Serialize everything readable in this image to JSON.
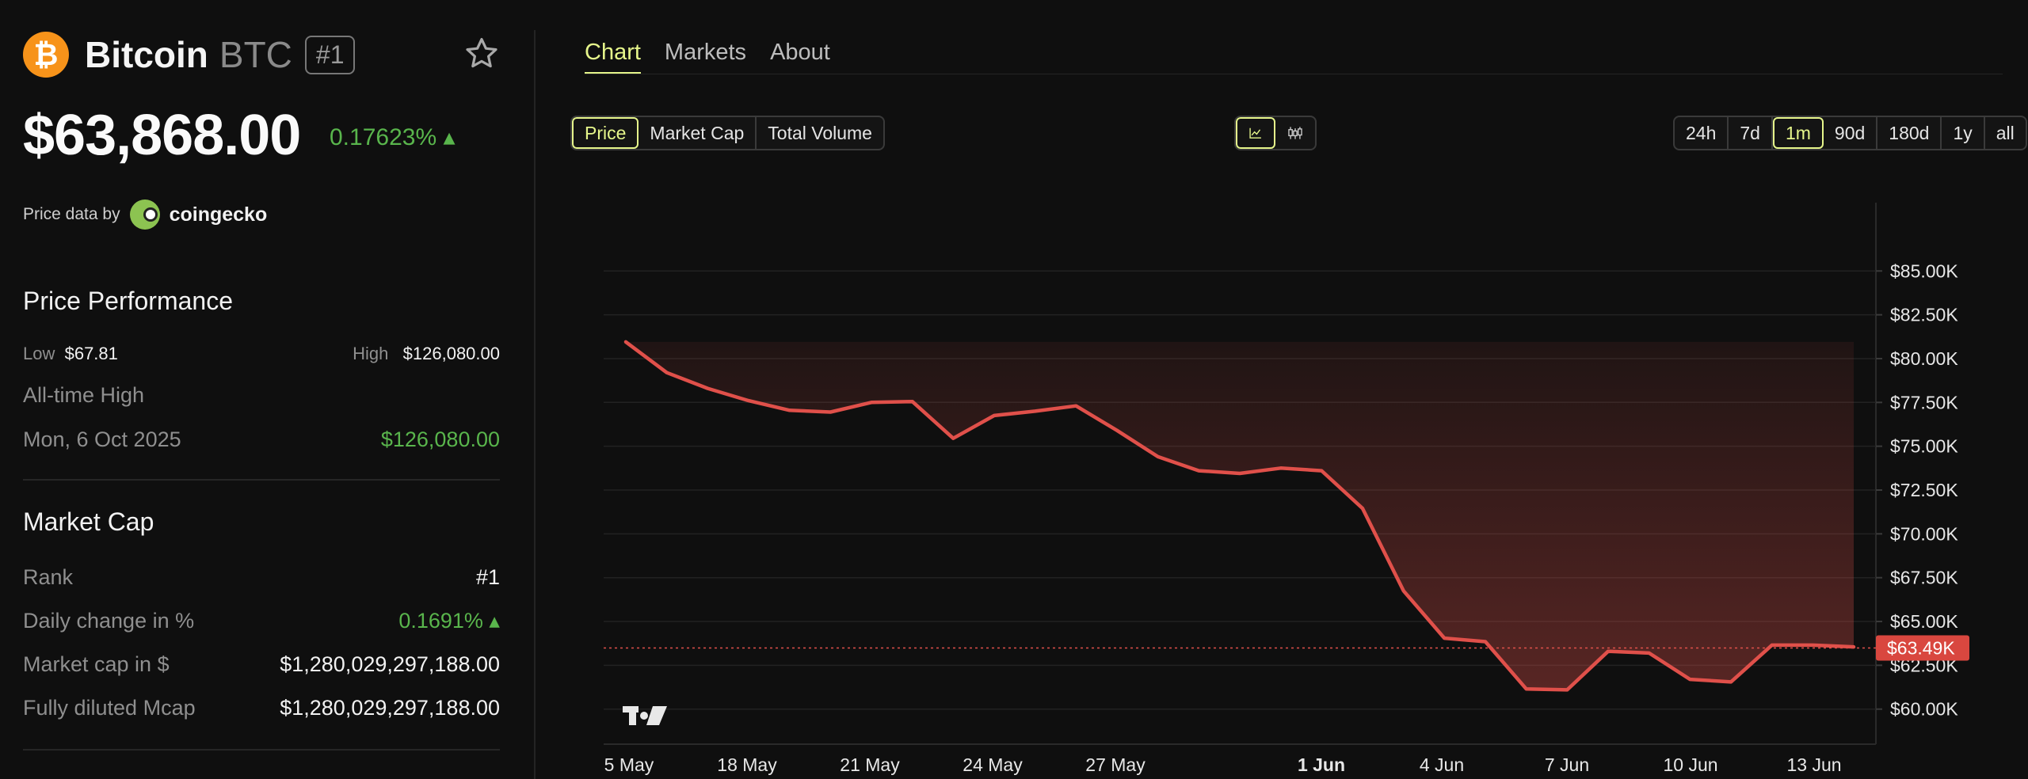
{
  "coin": {
    "name": "Bitcoin",
    "symbol": "BTC",
    "rank_badge": "#1",
    "price": "$63,868.00",
    "change_pct": "0.17623% ▴",
    "brand_color": "#f7931a",
    "logo_icon": "bitcoin-icon",
    "favorite_icon": "star-icon"
  },
  "price_data": {
    "label": "Price data by",
    "provider": "coingecko",
    "provider_icon": "coingecko-icon"
  },
  "performance": {
    "title": "Price Performance",
    "low_label": "Low",
    "low_value": "$67.81",
    "high_label": "High",
    "high_value": "$126,080.00",
    "ath_label": "All-time High",
    "ath_date": "Mon, 6 Oct 2025",
    "ath_value": "$126,080.00"
  },
  "market_cap": {
    "title": "Market Cap",
    "rows": [
      {
        "label": "Rank",
        "value": "#1"
      },
      {
        "label": "Daily change in %",
        "value": "0.1691% ▴"
      },
      {
        "label": "Market cap in $",
        "value": "$1,280,029,297,188.00"
      },
      {
        "label": "Fully diluted Mcap",
        "value": "$1,280,029,297,188.00"
      }
    ]
  },
  "tabs": [
    {
      "label": "Chart",
      "active": true
    },
    {
      "label": "Markets",
      "active": false
    },
    {
      "label": "About",
      "active": false
    }
  ],
  "metric_tabs": [
    {
      "label": "Price",
      "active": true
    },
    {
      "label": "Market Cap",
      "active": false
    },
    {
      "label": "Total Volume",
      "active": false
    }
  ],
  "chart_type_buttons": [
    {
      "icon": "line-chart-icon",
      "active": true
    },
    {
      "icon": "candlestick-icon",
      "active": false
    }
  ],
  "range_tabs": [
    {
      "label": "24h",
      "active": false
    },
    {
      "label": "7d",
      "active": false
    },
    {
      "label": "1m",
      "active": true
    },
    {
      "label": "90d",
      "active": false
    },
    {
      "label": "180d",
      "active": false
    },
    {
      "label": "1y",
      "active": false
    },
    {
      "label": "all",
      "active": false
    }
  ],
  "colors": {
    "accent": "#e6f68b",
    "line": "#e0504a",
    "positive": "#59b54c",
    "background": "#0f0f0f"
  },
  "chart_watermark_icon": "tradingview-icon",
  "chart_data": {
    "type": "area",
    "x_tick_labels": [
      "5 May",
      "18 May",
      "21 May",
      "24 May",
      "27 May",
      "1 Jun",
      "4 Jun",
      "7 Jun",
      "10 Jun",
      "13 Jun"
    ],
    "y_tick_labels": [
      "$85.00K",
      "$82.50K",
      "$80.00K",
      "$77.50K",
      "$75.00K",
      "$72.50K",
      "$70.00K",
      "$67.50K",
      "$65.00K",
      "$62.50K",
      "$60.00K"
    ],
    "ylim": [
      58000,
      87000
    ],
    "current_price_label": "$63.49K",
    "current_price": 63490,
    "series": [
      {
        "values": [
          80950,
          79200,
          78300,
          77600,
          77050,
          76950,
          77500,
          77550,
          75450,
          76750,
          77000,
          77300,
          75900,
          74400,
          73600,
          73450,
          73750,
          73600,
          71450,
          66750,
          64050,
          63850,
          61150,
          61100,
          63300,
          63200,
          61700,
          61550,
          63650,
          63650,
          63550
        ]
      }
    ],
    "grid": true
  }
}
